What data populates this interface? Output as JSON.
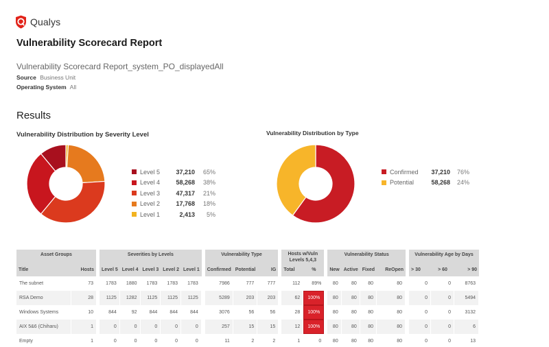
{
  "brand": {
    "name": "Qualys",
    "logo_icon": "qualys-shield-icon",
    "color": "#e2231a"
  },
  "report": {
    "title": "Vulnerability Scorecard Report",
    "name": "Vulnerability Scorecard Report_system_PO_displayedAll",
    "source_label": "Source",
    "source_value": "Business Unit",
    "os_label": "Operating System",
    "os_value": "All"
  },
  "results_title": "Results",
  "chart_data": [
    {
      "type": "pie",
      "title": "Vulnerability Distribution by Severity Level",
      "donut": true,
      "legend": "right",
      "series": [
        {
          "name": "Level 5",
          "value": 37210,
          "value_label": "37,210",
          "pct_label": "65%",
          "color": "#a8101e"
        },
        {
          "name": "Level 4",
          "value": 58268,
          "value_label": "58,268",
          "pct_label": "38%",
          "color": "#c8161e"
        },
        {
          "name": "Level 3",
          "value": 47317,
          "value_label": "47,317",
          "pct_label": "21%",
          "color": "#db3a1e"
        },
        {
          "name": "Level 2",
          "value": 17768,
          "value_label": "17,768",
          "pct_label": "18%",
          "color": "#e67a1e"
        },
        {
          "name": "Level 1",
          "value": 2413,
          "value_label": "2,413",
          "pct_label": "5%",
          "color": "#f2b320"
        }
      ],
      "slice_order_clockwise_from_top": [
        "Level 1",
        "Level 2",
        "Level 3",
        "Level 4",
        "Level 5"
      ],
      "slice_fractions": {
        "Level 1": 0.01,
        "Level 2": 0.23,
        "Level 3": 0.37,
        "Level 4": 0.28,
        "Level 5": 0.11
      }
    },
    {
      "type": "pie",
      "title": "Vulnerability Distribution by Type",
      "donut": true,
      "legend": "right",
      "series": [
        {
          "name": "Confirmed",
          "value": 37210,
          "value_label": "37,210",
          "pct_label": "76%",
          "color": "#c81c24"
        },
        {
          "name": "Potential",
          "value": 58268,
          "value_label": "58,268",
          "pct_label": "24%",
          "color": "#f7b52a"
        }
      ],
      "slice_order_clockwise_from_top": [
        "Confirmed",
        "Potential"
      ],
      "slice_fractions": {
        "Confirmed": 0.6,
        "Potential": 0.4
      }
    }
  ],
  "table": {
    "groups": [
      {
        "label": "Asset Groups",
        "cols": [
          "Title",
          "Hosts"
        ]
      },
      {
        "label": "Severities by Levels",
        "cols": [
          "Level 5",
          "Level 4",
          "Level 3",
          "Level 2",
          "Level 1"
        ]
      },
      {
        "label": "Vulnerability Type",
        "cols": [
          "Confirmed",
          "Potential",
          "IG"
        ]
      },
      {
        "label": "Hosts w/Vuln Levels 5,4,3",
        "cols": [
          "Total",
          "%"
        ]
      },
      {
        "label": "Vulnerability Status",
        "cols": [
          "New",
          "Active",
          "Fixed",
          "ReOpen"
        ]
      },
      {
        "label": "Vulnerability Age by Days",
        "cols": [
          "> 30",
          "> 60",
          "> 90"
        ]
      }
    ],
    "highlight_color": "#d9222a",
    "rows": [
      {
        "title": "The subnet",
        "hosts": "73",
        "sev": [
          "1783",
          "1880",
          "1783",
          "1783",
          "1783"
        ],
        "type": [
          "7986",
          "777",
          "777"
        ],
        "hv_total": "112",
        "hv_pct": "89%",
        "hv_pct_highlight": false,
        "status": [
          "80",
          "80",
          "80",
          "80"
        ],
        "age": [
          "0",
          "0",
          "8763"
        ]
      },
      {
        "title": "RSA Demo",
        "hosts": "28",
        "sev": [
          "1125",
          "1282",
          "1125",
          "1125",
          "1125"
        ],
        "type": [
          "5289",
          "203",
          "203"
        ],
        "hv_total": "62",
        "hv_pct": "100%",
        "hv_pct_highlight": true,
        "status": [
          "80",
          "80",
          "80",
          "80"
        ],
        "age": [
          "0",
          "0",
          "5494"
        ]
      },
      {
        "title": "Windows Systems",
        "hosts": "10",
        "sev": [
          "844",
          "92",
          "844",
          "844",
          "844"
        ],
        "type": [
          "3076",
          "56",
          "56"
        ],
        "hv_total": "28",
        "hv_pct": "100%",
        "hv_pct_highlight": true,
        "status": [
          "80",
          "80",
          "80",
          "80"
        ],
        "age": [
          "0",
          "0",
          "3132"
        ]
      },
      {
        "title": "AIX 5&6 (Chiharu)",
        "hosts": "1",
        "sev": [
          "0",
          "0",
          "0",
          "0",
          "0"
        ],
        "type": [
          "257",
          "15",
          "15"
        ],
        "hv_total": "12",
        "hv_pct": "100%",
        "hv_pct_highlight": true,
        "status": [
          "80",
          "80",
          "80",
          "80"
        ],
        "age": [
          "0",
          "0",
          "6"
        ]
      },
      {
        "title": "Empty",
        "hosts": "1",
        "sev": [
          "0",
          "0",
          "0",
          "0",
          "0"
        ],
        "type": [
          "11",
          "2",
          "2"
        ],
        "hv_total": "1",
        "hv_pct": "0",
        "hv_pct_highlight": false,
        "status": [
          "80",
          "80",
          "80",
          "80"
        ],
        "age": [
          "0",
          "0",
          "13"
        ]
      }
    ]
  }
}
